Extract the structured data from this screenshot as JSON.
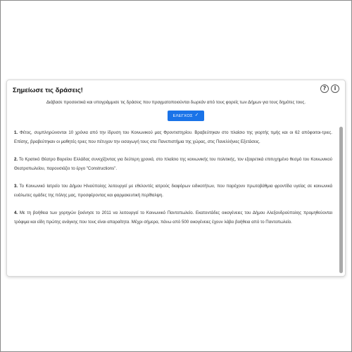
{
  "dialog": {
    "title": "Σημείωσε τις δράσεις!",
    "subtitle": "Διάβασε προσεκτικά και υπογράμμισε τις δράσεις που πραγματοποιούνται δωρεάν από τους φορείς των Δήμων για τους δημότες τους.",
    "help_icon": "question-icon",
    "info_icon": "info-icon",
    "done_label": "ΕΛΕΓΧΟΣ",
    "done_icon": "check-icon"
  },
  "items": [
    {
      "number": "1.",
      "text": "Φέτος, συμπληρώνονται 10 χρόνια από την ίδρυση του Κοινωνικού μας Φροντιστηρίου. Βραβεύτηκαν στο πλαίσιο της γιορτής τιμής και οι 62 απόφοιτοι-τριες. Επίσης, βραβεύτηκαν οι μαθητές-τριες που πέτυχαν την εισαγωγή τους στα Πανεπιστήμια της χώρας, στις Πανελλήνιες Εξετάσεις."
    },
    {
      "number": "2.",
      "text": "Το Κρατικό Θέατρο Βορείου Ελλάδας συνεχίζοντας για δεύτερη χρονιά, στο πλαίσιο της κοινωνικής του πολιτικής, τον εξαιρετικά επιτυχημένο θεσμό του Κοινωνικού Θεατροπωλείου, παρουσιάζει το έργο \"Constructions\"."
    },
    {
      "number": "3.",
      "text": "Το Κοινωνικό Ιατρείο του Δήμου Ηλιούπολης λειτουργεί με εθελοντές ιατρούς διαφόρων ειδικοτήτων, που παρέχουν πρωτοβάθμια φροντίδα υγείας σε κοινωνικά ευάλωτες ομάδες της πόλης μας, προσφέροντας και φαρμακευτική περίθαλψη."
    },
    {
      "number": "4.",
      "text": "Με τη βοήθεια των χορηγών ξεκίνησε το 2011 να λειτουργεί το Κοινωνικό Παντοπωλείο. Εκατοντάδες οικογένειες του Δήμου Αλεξανδρούπολης προμηθεύονται τρόφιμα και είδη πρώτης ανάγκης που τους είναι απαραίτητα. Μέχρι σήμερα, πάνω από 500 οικογένειες έχουν λάβει βοήθεια από το Παντοπωλείο."
    }
  ],
  "colors": {
    "accent": "#1a73e8",
    "scrollbar": "#a9a9a9"
  }
}
